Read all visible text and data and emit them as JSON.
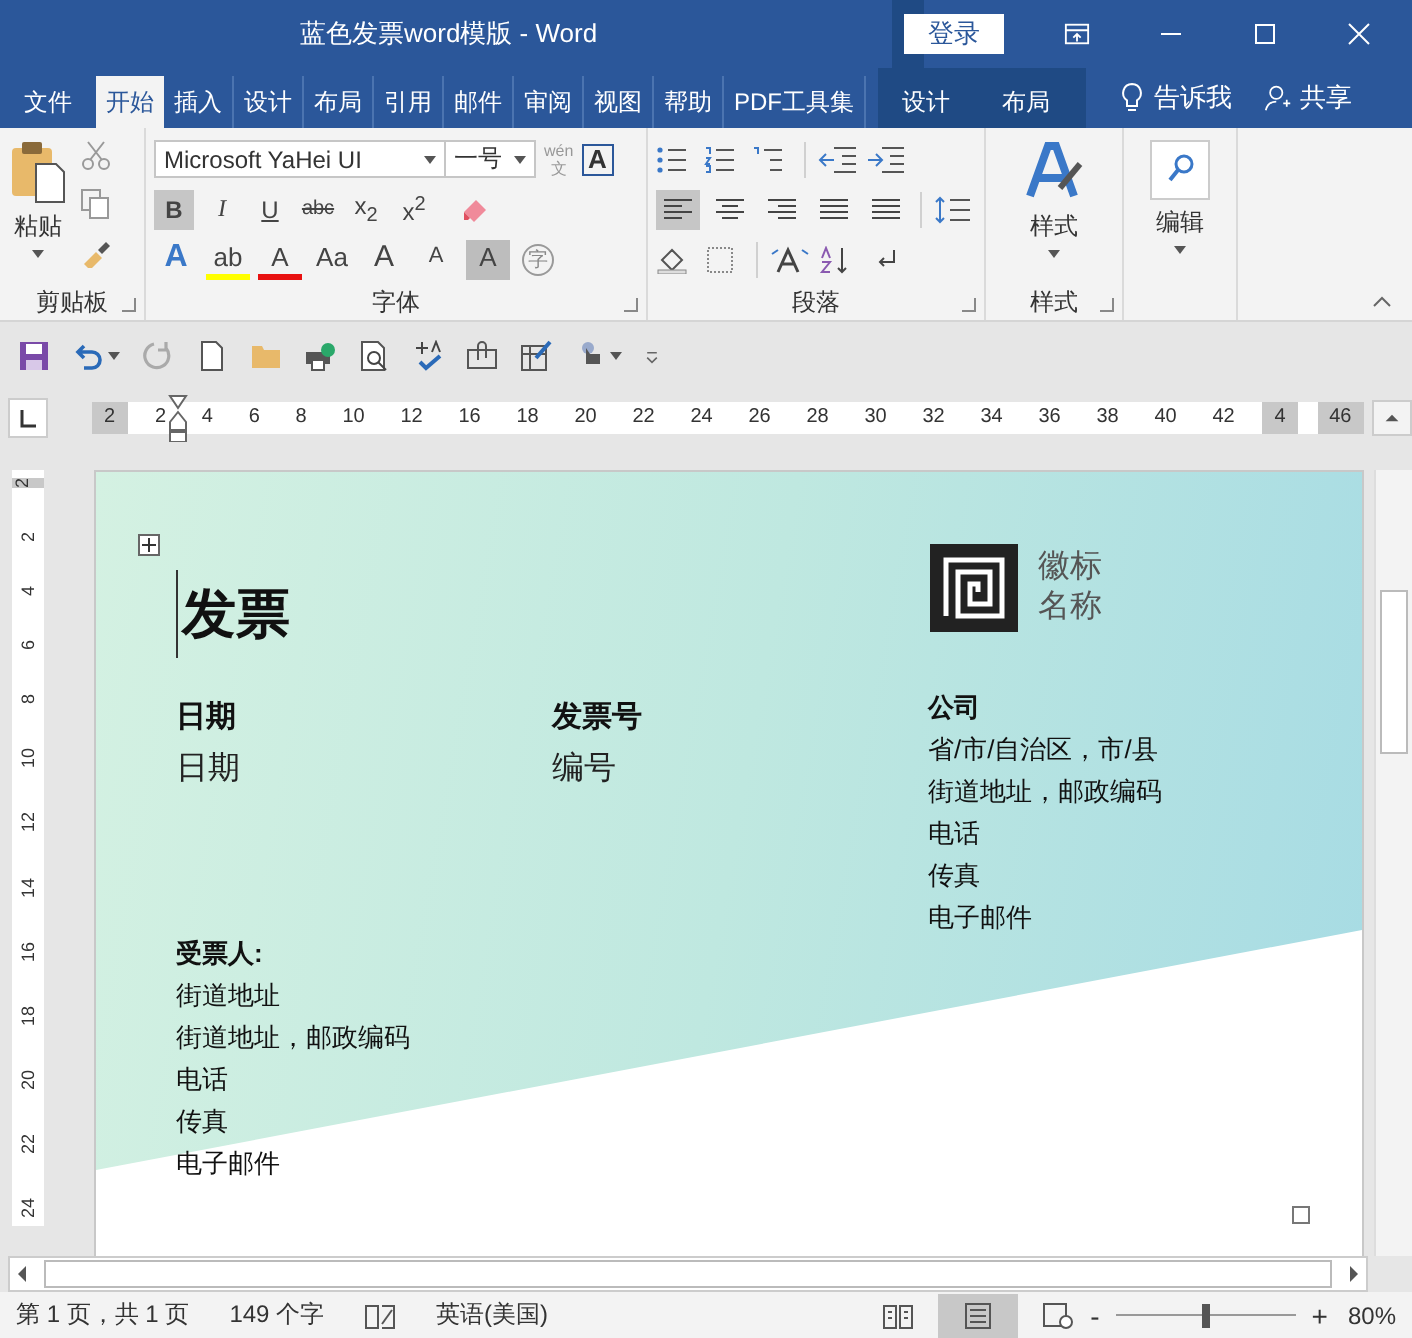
{
  "window": {
    "title": "蓝色发票word模版  -  Word",
    "login": "登录"
  },
  "tabs": [
    {
      "label": "文件",
      "selected": false
    },
    {
      "label": "开始",
      "selected": true
    },
    {
      "label": "插入",
      "selected": false
    },
    {
      "label": "设计",
      "selected": false
    },
    {
      "label": "布局",
      "selected": false
    },
    {
      "label": "引用",
      "selected": false
    },
    {
      "label": "邮件",
      "selected": false
    },
    {
      "label": "审阅",
      "selected": false
    },
    {
      "label": "视图",
      "selected": false
    },
    {
      "label": "帮助",
      "selected": false
    },
    {
      "label": "PDF工具集",
      "selected": false
    }
  ],
  "context_tabs": [
    {
      "label": "设计"
    },
    {
      "label": "布局"
    }
  ],
  "tell_me": "告诉我",
  "share": "共享",
  "ribbon": {
    "clipboard": {
      "paste": "粘贴",
      "label": "剪贴板"
    },
    "font": {
      "name": "Microsoft YaHei UI",
      "size": "一号",
      "phonetic": [
        "wén",
        "文"
      ],
      "border_char": "A",
      "label": "字体",
      "row2": [
        {
          "glyph": "B",
          "kind": "bold",
          "selected": true
        },
        {
          "glyph": "I",
          "kind": "italic",
          "selected": false
        },
        {
          "glyph": "U",
          "kind": "underline",
          "selected": false
        },
        {
          "glyph": "abc",
          "kind": "strike",
          "selected": false
        },
        {
          "glyph": "x$_{2}$",
          "kind": "plain",
          "selected": false
        },
        {
          "glyph": "x$^{2}$",
          "kind": "plain",
          "selected": false
        }
      ],
      "row3": [
        {
          "glyph": "A",
          "kind": "effect",
          "color": "#3a78c8"
        },
        {
          "glyph": "ab",
          "kind": "highlight",
          "color": "#ffff00"
        },
        {
          "glyph": "A",
          "kind": "fontcolor",
          "color": "#e81010"
        },
        {
          "glyph": "Aa",
          "kind": "plain",
          "color": "#444444"
        },
        {
          "glyph": "A",
          "kind": "grow",
          "color": "#444444"
        },
        {
          "glyph": "A",
          "kind": "shrink",
          "color": "#444444"
        },
        {
          "glyph": "A",
          "kind": "shade",
          "color": "#444444"
        },
        {
          "glyph": "字",
          "kind": "circle",
          "color": "#888888"
        }
      ]
    },
    "paragraph": {
      "label": "段落",
      "align": [
        {
          "selected": true
        },
        {
          "selected": false
        },
        {
          "selected": false
        },
        {
          "selected": false
        },
        {
          "selected": false
        }
      ]
    },
    "styles": {
      "button": "样式",
      "label": "样式"
    },
    "editing": {
      "button": "编辑"
    }
  },
  "ruler": [
    {
      "t": "2",
      "margin": true
    },
    {
      "t": "2",
      "margin": false
    },
    {
      "t": "4",
      "margin": false
    },
    {
      "t": "6",
      "margin": false
    },
    {
      "t": "8",
      "margin": false
    },
    {
      "t": "10",
      "margin": false
    },
    {
      "t": "12",
      "margin": false
    },
    {
      "t": "16",
      "margin": false
    },
    {
      "t": "18",
      "margin": false
    },
    {
      "t": "20",
      "margin": false
    },
    {
      "t": "22",
      "margin": false
    },
    {
      "t": "24",
      "margin": false
    },
    {
      "t": "26",
      "margin": false
    },
    {
      "t": "28",
      "margin": false
    },
    {
      "t": "30",
      "margin": false
    },
    {
      "t": "32",
      "margin": false
    },
    {
      "t": "34",
      "margin": false
    },
    {
      "t": "36",
      "margin": false
    },
    {
      "t": "38",
      "margin": false
    },
    {
      "t": "40",
      "margin": false
    },
    {
      "t": "42",
      "margin": false
    },
    {
      "t": "4",
      "margin": true
    },
    {
      "t": "46",
      "margin": true
    }
  ],
  "vruler": [
    {
      "t": "2",
      "margin": true
    },
    {
      "t": "2",
      "margin": false
    },
    {
      "t": "4",
      "margin": false
    },
    {
      "t": "6",
      "margin": false
    },
    {
      "t": "8",
      "margin": false
    },
    {
      "t": "10",
      "margin": false
    },
    {
      "t": "12",
      "margin": false
    },
    {
      "t": "14",
      "margin": false
    },
    {
      "t": "16",
      "margin": false
    },
    {
      "t": "18",
      "margin": false
    },
    {
      "t": "20",
      "margin": false
    },
    {
      "t": "22",
      "margin": false
    },
    {
      "t": "24",
      "margin": false
    }
  ],
  "document": {
    "title": "发票",
    "logo": [
      "徽标",
      "名称"
    ],
    "date": {
      "label": "日期",
      "value": "日期"
    },
    "number": {
      "label": "发票号",
      "value": "编号"
    },
    "company": {
      "label": "公司",
      "lines": [
        "省/市/自治区，市/县",
        "街道地址，邮政编码",
        "电话",
        "传真",
        "电子邮件"
      ]
    },
    "recipient": {
      "label": "受票人:",
      "lines": [
        "街道地址",
        "街道地址，邮政编码",
        "电话",
        "传真",
        "电子邮件"
      ]
    }
  },
  "status_bar": {
    "page": "第 1 页，共 1 页",
    "words": "149 个字",
    "language": "英语(美国)",
    "zoom_minus": "-",
    "zoom_plus": "+",
    "zoom": "80%",
    "zoom_slider": {
      "level": 0.5
    }
  }
}
